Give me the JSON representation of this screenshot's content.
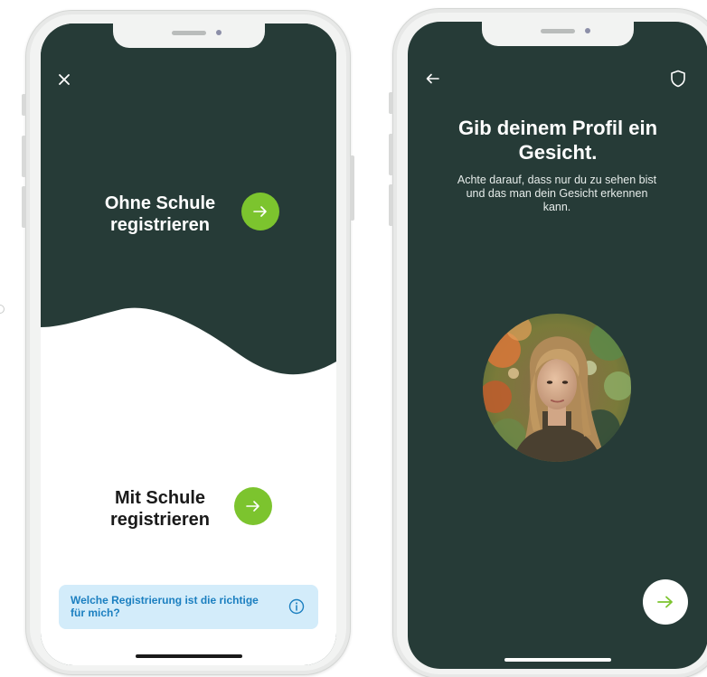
{
  "left_screen": {
    "close_icon": "close-icon",
    "without_school": {
      "title_line1": "Ohne Schule",
      "title_line2": "registrieren",
      "arrow_icon": "arrow-right-icon"
    },
    "with_school": {
      "title_line1": "Mit Schule",
      "title_line2": "registrieren",
      "arrow_icon": "arrow-right-icon"
    },
    "help_banner": {
      "text": "Welche Registrierung ist die richtige für mich?",
      "info_icon": "info-icon"
    }
  },
  "right_screen": {
    "back_icon": "arrow-left-icon",
    "shield_icon": "shield-icon",
    "title_line1": "Gib deinem Profil ein",
    "title_line2": "Gesicht.",
    "subtitle_line1": "Achte darauf, dass nur du zu sehen bist",
    "subtitle_line2": "und das man dein Gesicht erkennen",
    "subtitle_line3": "kann.",
    "avatar_icon": "profile-photo",
    "next_icon": "arrow-right-icon"
  },
  "colors": {
    "dark_green": "#263b37",
    "accent_green": "#7cc42e",
    "help_bg": "#d3ecfa",
    "help_text": "#1b7fc0"
  }
}
